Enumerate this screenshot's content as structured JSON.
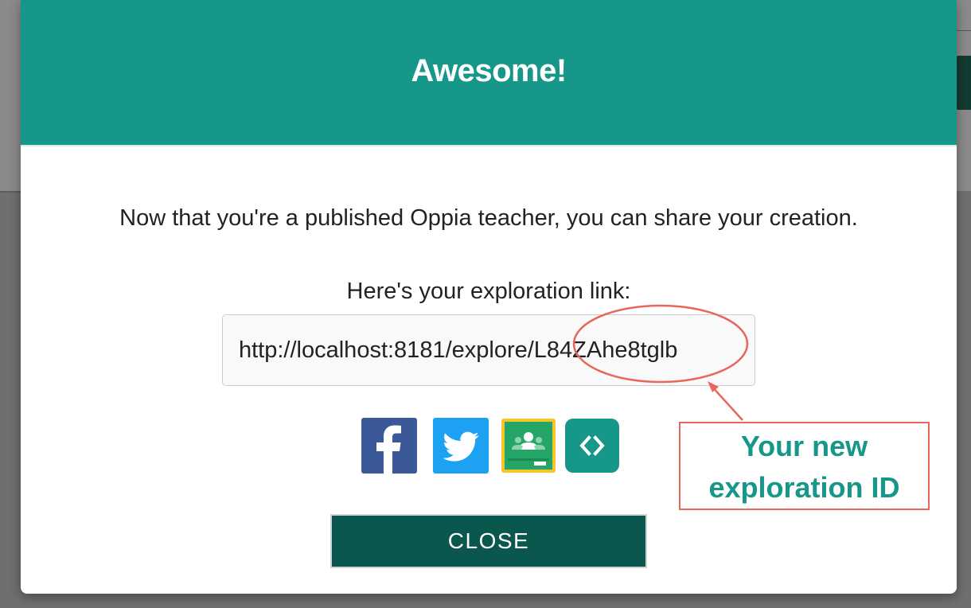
{
  "modal": {
    "title": "Awesome!",
    "share_message": "Now that you're a published Oppia teacher, you can share your creation.",
    "link_label": "Here's your exploration link:",
    "link_value": "http://localhost:8181/explore/L84ZAhe8tglb",
    "close_label": "CLOSE"
  },
  "share_buttons": [
    {
      "name": "facebook",
      "icon": "facebook-icon",
      "color": "#3b5998"
    },
    {
      "name": "twitter",
      "icon": "twitter-icon",
      "color": "#1da1f2"
    },
    {
      "name": "google-classroom",
      "icon": "google-classroom-icon",
      "color": "#25a667"
    },
    {
      "name": "embed",
      "icon": "embed-code-icon",
      "color": "#16978a"
    }
  ],
  "annotation": {
    "line1": "Your new",
    "line2": "exploration ID",
    "color": "#e9675a"
  },
  "colors": {
    "header": "#16978a",
    "close_button": "#0a584d",
    "annotation_text": "#16978a"
  }
}
